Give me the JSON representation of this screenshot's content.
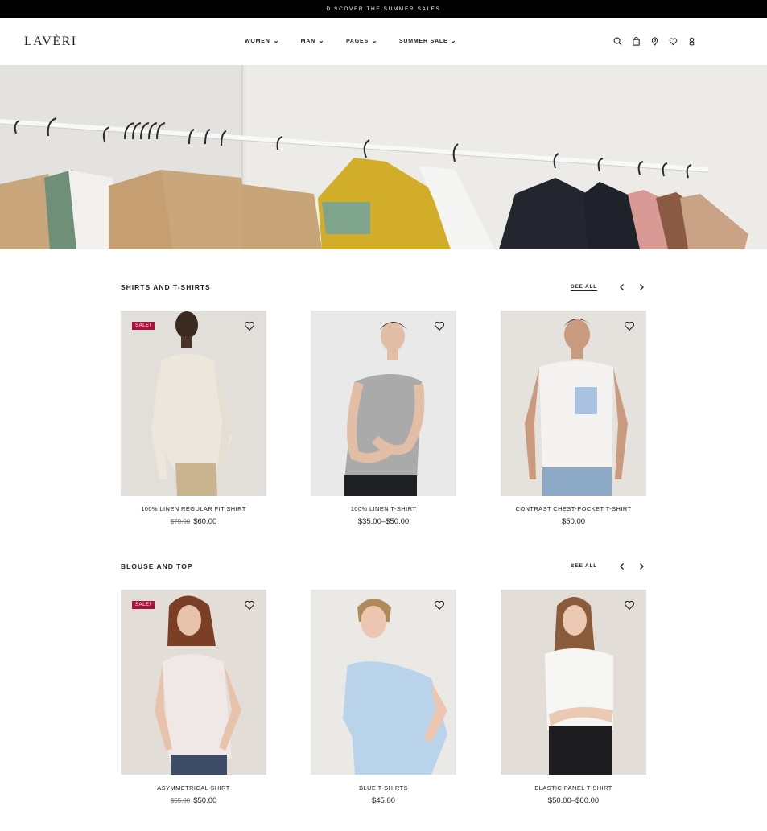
{
  "topbar": {
    "text": "DISCOVER THE SUMMER SALES"
  },
  "header": {
    "logo": "LAVÈRI",
    "nav": [
      {
        "label": "WOMEN"
      },
      {
        "label": "MAN"
      },
      {
        "label": "PAGES"
      },
      {
        "label": "SUMMER SALE"
      }
    ],
    "icons": [
      "search-icon",
      "bag-icon",
      "location-icon",
      "heart-icon",
      "user-icon"
    ]
  },
  "sections": [
    {
      "title": "SHIRTS AND T-SHIRTS",
      "see_all": "SEE ALL",
      "products": [
        {
          "name": "100% LINEN REGULAR FIT SHIRT",
          "old_price": "$70.00",
          "price": "$60.00",
          "badge": "SALE!"
        },
        {
          "name": "100% LINEN T-SHIRT",
          "old_price": "",
          "price": "$35.00–$50.00",
          "badge": ""
        },
        {
          "name": "CONTRAST CHEST-POCKET T-SHIRT",
          "old_price": "",
          "price": "$50.00",
          "badge": ""
        }
      ]
    },
    {
      "title": "BLOUSE AND TOP",
      "see_all": "SEE ALL",
      "products": [
        {
          "name": "ASYMMETRICAL SHIRT",
          "old_price": "$55.00",
          "price": "$50.00",
          "badge": "SALE!"
        },
        {
          "name": "BLUE T-SHIRTS",
          "old_price": "",
          "price": "$45.00",
          "badge": ""
        },
        {
          "name": "ELASTIC PANEL T-SHIRT",
          "old_price": "",
          "price": "$50.00–$60.00",
          "badge": ""
        }
      ]
    }
  ],
  "colors": {
    "accent_sale": "#a8123c",
    "topbar_bg": "#000000",
    "text": "#222222"
  }
}
